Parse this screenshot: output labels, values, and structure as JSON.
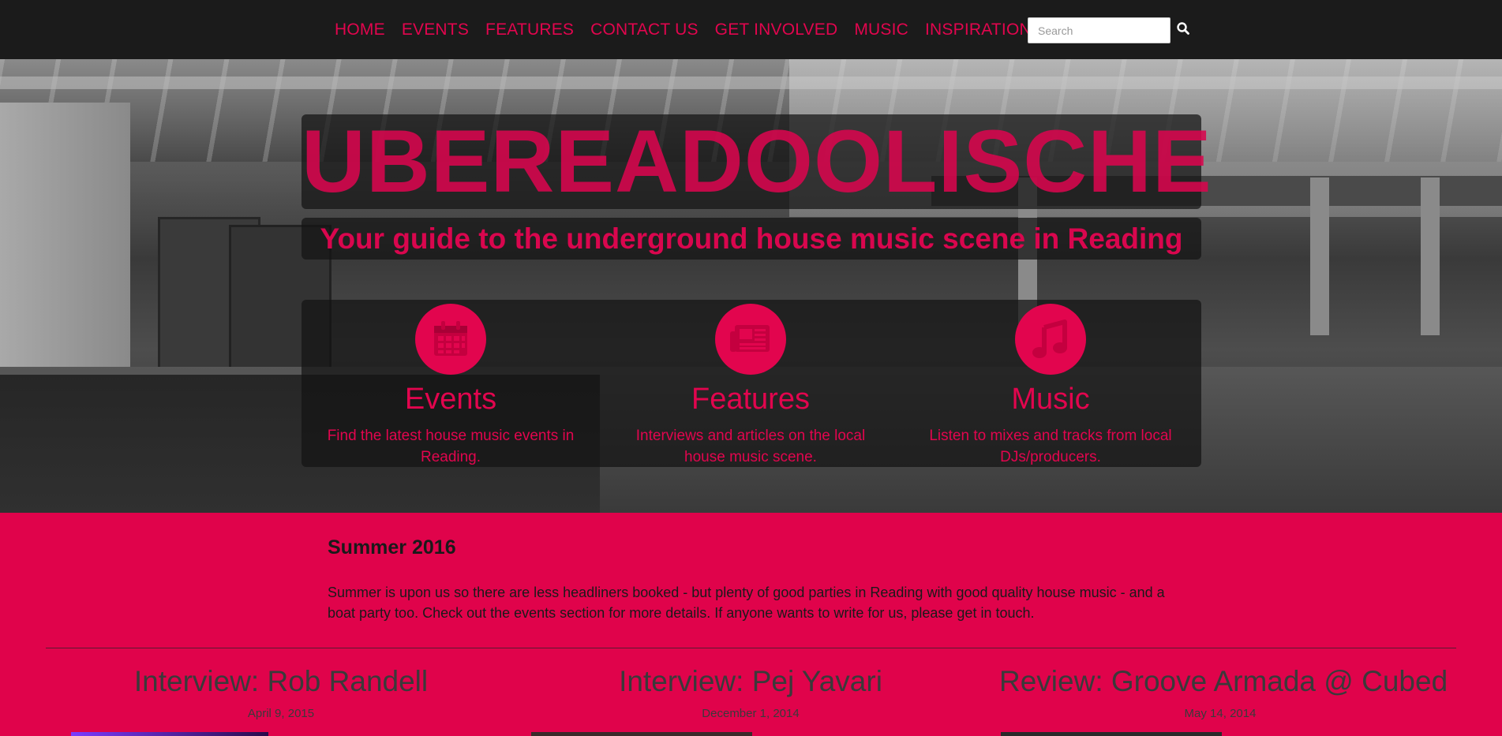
{
  "nav": {
    "items": [
      "HOME",
      "EVENTS",
      "FEATURES",
      "CONTACT US",
      "GET INVOLVED",
      "MUSIC",
      "INSPIRATIONS"
    ],
    "search_placeholder": "Search",
    "search_icon": "search-icon"
  },
  "hero": {
    "title": "UBEREADOOLISCHE",
    "subtitle": "Your guide to the underground house music scene in Reading",
    "features": [
      {
        "icon": "calendar-icon",
        "title": "Events",
        "description": "Find the latest house music events in Reading."
      },
      {
        "icon": "newspaper-icon",
        "title": "Features",
        "description": "Interviews and articles on the local house music scene."
      },
      {
        "icon": "music-note-icon",
        "title": "Music",
        "description": "Listen to mixes and tracks from local DJs/producers."
      }
    ]
  },
  "news": {
    "title": "Summer 2016",
    "body": "Summer is upon us so there are less headliners booked - but plenty of good parties in Reading with good quality house music - and a boat party too. Check out the events section for more details. If anyone wants to write for us, please get in touch."
  },
  "articles": [
    {
      "title": "Interview: Rob Randell",
      "date": "April 9, 2015"
    },
    {
      "title": "Interview: Pej Yavari",
      "date": "December 1, 2014"
    },
    {
      "title": "Review: Groove Armada @ Cubed",
      "date": "May 14, 2014"
    }
  ],
  "colors": {
    "accent": "#e2054e",
    "navbar": "#1b1b1b",
    "pink_bg": "#e0034b"
  }
}
